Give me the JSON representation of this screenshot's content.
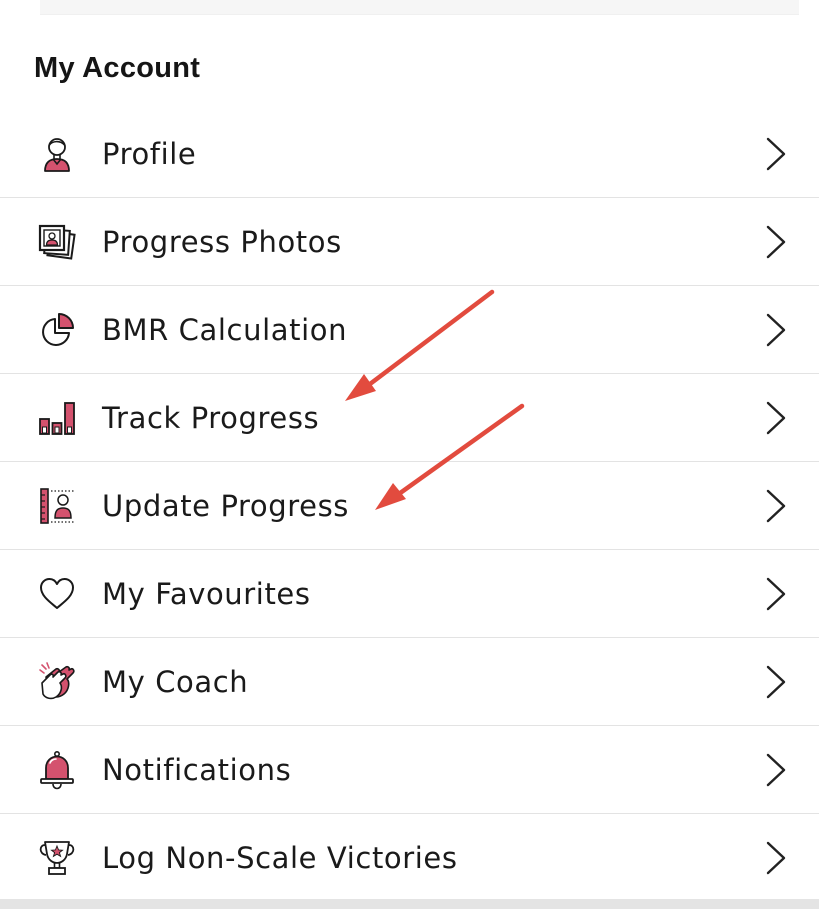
{
  "section": {
    "title": "My Account"
  },
  "menu": {
    "items": [
      {
        "label": "Profile",
        "icon": "profile-icon"
      },
      {
        "label": "Progress Photos",
        "icon": "photos-icon"
      },
      {
        "label": "BMR Calculation",
        "icon": "pie-chart-icon"
      },
      {
        "label": "Track Progress",
        "icon": "bar-chart-icon"
      },
      {
        "label": "Update Progress",
        "icon": "measure-icon"
      },
      {
        "label": "My Favourites",
        "icon": "heart-icon"
      },
      {
        "label": "My Coach",
        "icon": "clapping-hands-icon"
      },
      {
        "label": "Notifications",
        "icon": "bell-icon"
      },
      {
        "label": "Log Non-Scale Victories",
        "icon": "trophy-icon"
      }
    ]
  },
  "colors": {
    "accent": "#d4526e",
    "arrow": "#e24b3e",
    "divider": "#e3e3e3",
    "text": "#1a1a1a"
  }
}
